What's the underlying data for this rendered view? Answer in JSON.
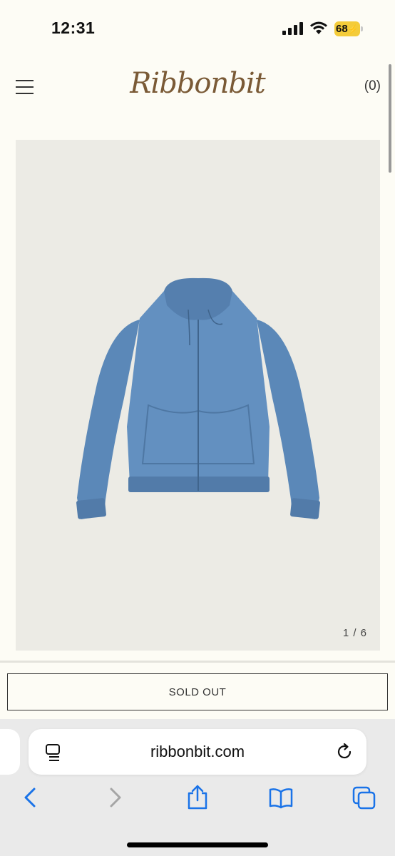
{
  "status_bar": {
    "time": "12:31",
    "battery_level": "68",
    "battery_color": "#f4cc3a",
    "icons": [
      "cellular-signal-icon",
      "wifi-icon",
      "battery-charging-icon"
    ]
  },
  "header": {
    "menu_icon": "hamburger-menu-icon",
    "logo_text": "Ribbonbit",
    "cart_label": "(0)"
  },
  "product": {
    "image_description_icon": "blue-zip-hoodie",
    "image_counter": "1 / 6",
    "hoodie_color": "#5b88b8"
  },
  "actions": {
    "sold_out_label": "SOLD OUT"
  },
  "browser": {
    "url": "ribbonbit.com",
    "icons": [
      "reader-tabs-icon",
      "reload-icon",
      "back-icon",
      "forward-icon",
      "share-icon",
      "bookmarks-icon",
      "tabs-icon"
    ]
  },
  "colors": {
    "page_background": "#fdfcf5",
    "logo_brown": "#7a5a36",
    "ios_blue": "#1a73e8"
  }
}
